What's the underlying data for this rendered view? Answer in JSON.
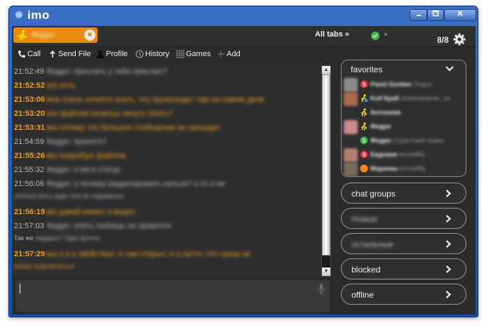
{
  "app": {
    "title": "imo"
  },
  "tab": {
    "name": "Федро"
  },
  "header": {
    "all_tabs": "All tabs »",
    "count": "8/8"
  },
  "toolbar": {
    "call": "Call",
    "send_file": "Send File",
    "profile": "Profile",
    "history": "History",
    "games": "Games",
    "add": "Add"
  },
  "messages": [
    {
      "time": "21:52:49",
      "who": "them",
      "text": "Федро: прислать у тебя прислал?"
    },
    {
      "time": "21:52:52",
      "who": "me",
      "text": "ага есть"
    },
    {
      "time": "21:53:06",
      "who": "me",
      "text": "мне очень хочется знать, что происходит там на самом деле"
    },
    {
      "time": "21:53:20",
      "who": "me",
      "text": "это файлом можешь кинуть опять?"
    },
    {
      "time": "21:53:31",
      "who": "me",
      "text": "мы потому что большое сообщение не проходит"
    },
    {
      "time": "21:54:59",
      "who": "them",
      "text": "Федро: принято?"
    },
    {
      "time": "21:55:26",
      "who": "me",
      "text": "мы попробую файлом"
    },
    {
      "time": "21:55:32",
      "who": "them",
      "text": "Федро: я им в статус"
    },
    {
      "time": "21:56:06",
      "who": "them",
      "text": "Федро: а почему редактировать нельзя? а то я не"
    },
    {
      "time": "21:56:19",
      "who": "me",
      "text": "мы давай может я видео"
    },
    {
      "time": "21:57:03",
      "who": "them",
      "text": "Федро: опять любишь не нравится"
    },
    {
      "time": "21:57:29",
      "who": "me",
      "text": "мы я в в свойствах, я там открыл, я и пусто, что сразу не"
    }
  ],
  "wraps": [
    {
      "who": "them",
      "pre": "",
      "text": "сколько могу надо чем не подумаешь"
    },
    {
      "who": "them",
      "pre": "Так же ",
      "text": "подарок? Туда прочти"
    },
    {
      "who": "me",
      "pre": "",
      "text": "всему подключиться"
    }
  ],
  "favorites": {
    "title": "favorites",
    "contacts": [
      {
        "name": "Pavel Gordon",
        "msg": "Отдых",
        "avatar": "#8a8a8a",
        "status": "skype"
      },
      {
        "name": "Ksif Краб",
        "msg": "Инопланетян, ты",
        "avatar": "#a86a4a",
        "status": "runner-skype"
      },
      {
        "name": "Антонова",
        "msg": "",
        "avatar": "",
        "status": "runner"
      },
      {
        "name": "Федро",
        "msg": "",
        "avatar": "#c98a8a",
        "status": "runner"
      },
      {
        "name": "Федро",
        "msg": "Страстный нужен",
        "avatar": "",
        "status": "skype-green"
      },
      {
        "name": "Евдокия",
        "msg": "котлейбу",
        "avatar": "#b07e72",
        "status": "skype"
      },
      {
        "name": "Маринка",
        "msg": "котлейбу",
        "avatar": "#7a6a5a",
        "status": "orange"
      }
    ]
  },
  "groups": [
    {
      "label": "chat groups",
      "blur": false
    },
    {
      "label": "Новые",
      "blur": true
    },
    {
      "label": "остальные",
      "blur": true
    },
    {
      "label": "blocked",
      "blur": false
    },
    {
      "label": "offline",
      "blur": false
    }
  ],
  "colors": {
    "accent_orange": "#e98a10",
    "my_message": "#f0a020",
    "their_message": "#b9b9b9",
    "titlebar_blue": "#2a5ab5",
    "background": "#2b2b2b"
  },
  "icons": {
    "runner": "runner-icon",
    "skype": "skype-icon",
    "gear": "gear-icon",
    "mic": "microphone-icon"
  }
}
